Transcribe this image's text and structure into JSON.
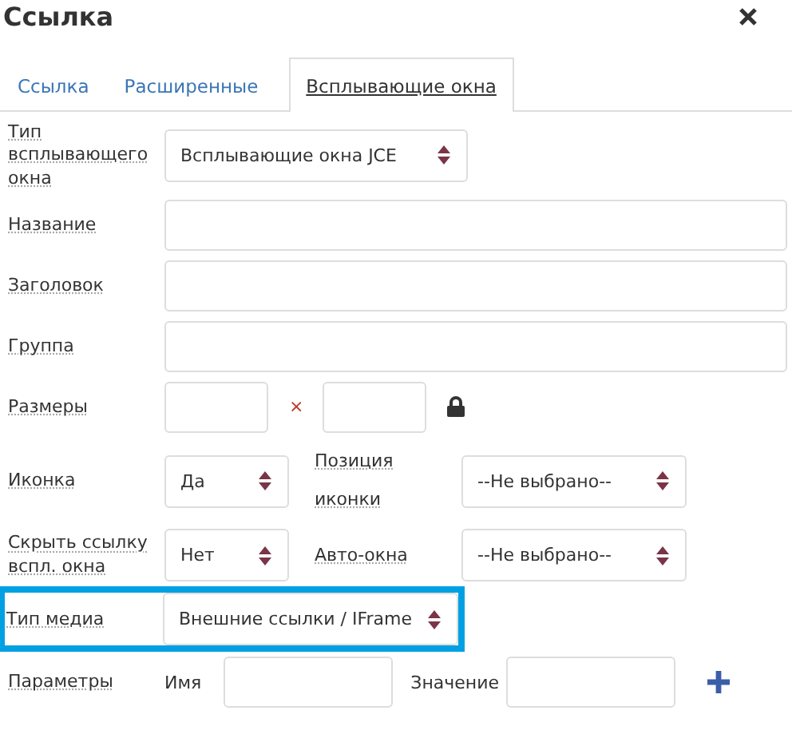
{
  "window": {
    "title": "Ссылка"
  },
  "tabs": [
    {
      "label": "Ссылка",
      "selected": false
    },
    {
      "label": "Расширенные",
      "selected": false
    },
    {
      "label": "Всплывающие окна",
      "selected": true
    }
  ],
  "form": {
    "rows": [
      {
        "kind": "select",
        "label": "Тип всплывающего окна",
        "value": "Всплывающие окна JCE",
        "highlighted": false
      },
      {
        "kind": "text",
        "label": "Название"
      },
      {
        "kind": "text",
        "label": "Заголовок"
      },
      {
        "kind": "text",
        "label": "Группа"
      },
      {
        "kind": "size",
        "label": "Размеры",
        "separator": "×"
      },
      {
        "kind": "pair",
        "label": "Иконка",
        "value": "Да",
        "label2": "Позиция иконки",
        "value2": "--Не выбрано--"
      },
      {
        "kind": "pair",
        "label": "Скрыть ссылку вспл. окна",
        "value": "Нет",
        "label2": "Авто-окна",
        "value2": "--Не выбрано--"
      },
      {
        "kind": "select",
        "label": "Тип медиа",
        "value": "Внешние ссылки / IFrame",
        "highlighted": true
      },
      {
        "kind": "params",
        "label": "Параметры",
        "name_label": "Имя",
        "value_label": "Значение"
      }
    ]
  }
}
